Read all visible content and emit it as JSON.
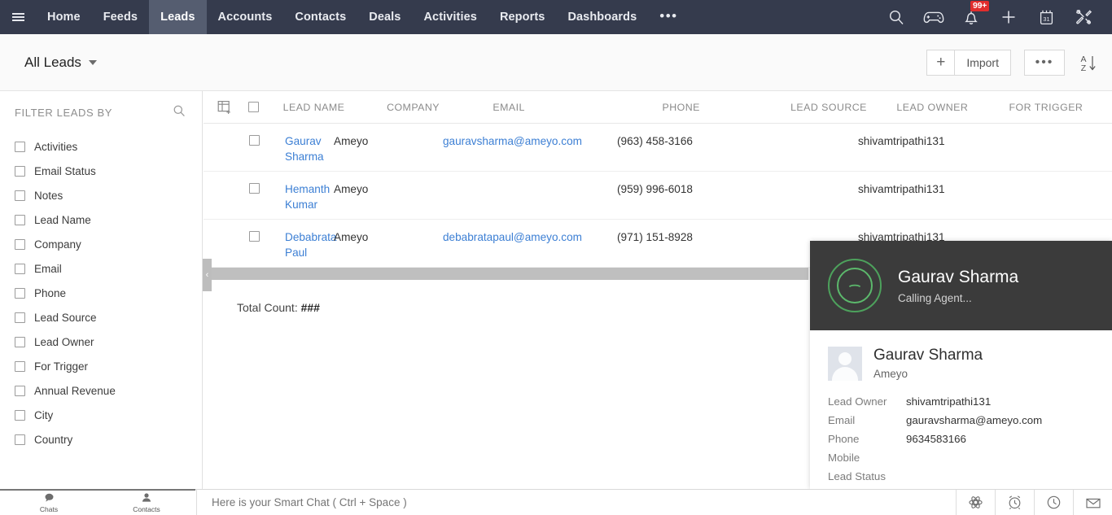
{
  "topnav": {
    "menu_icon": "hamburger-icon",
    "items": [
      {
        "label": "Home",
        "active": false
      },
      {
        "label": "Feeds",
        "active": false
      },
      {
        "label": "Leads",
        "active": true
      },
      {
        "label": "Accounts",
        "active": false
      },
      {
        "label": "Contacts",
        "active": false
      },
      {
        "label": "Deals",
        "active": false
      },
      {
        "label": "Activities",
        "active": false
      },
      {
        "label": "Reports",
        "active": false
      },
      {
        "label": "Dashboards",
        "active": false
      }
    ],
    "more_label": "•••",
    "icons": {
      "search": "search-icon",
      "gamepad": "gamepad-icon",
      "bell": "bell-icon",
      "bell_badge": "99+",
      "plus": "plus-icon",
      "calendar": "calendar-icon",
      "calendar_day": "31",
      "tools": "tools-icon"
    }
  },
  "subbar": {
    "view_name": "All Leads",
    "plus_label": "+",
    "import_label": "Import",
    "more_label": "•••",
    "sort_top": "A",
    "sort_bottom": "Z",
    "sort_arrow": "↓"
  },
  "sidebar": {
    "title": "FILTER LEADS BY",
    "search_icon": "search-icon",
    "filters": [
      {
        "label": "Activities",
        "checked": false
      },
      {
        "label": "Email Status",
        "checked": false
      },
      {
        "label": "Notes",
        "checked": false
      },
      {
        "label": "Lead Name",
        "checked": false
      },
      {
        "label": "Company",
        "checked": false
      },
      {
        "label": "Email",
        "checked": false
      },
      {
        "label": "Phone",
        "checked": false
      },
      {
        "label": "Lead Source",
        "checked": false
      },
      {
        "label": "Lead Owner",
        "checked": false
      },
      {
        "label": "For Trigger",
        "checked": false
      },
      {
        "label": "Annual Revenue",
        "checked": false
      },
      {
        "label": "City",
        "checked": false
      },
      {
        "label": "Country",
        "checked": false
      }
    ],
    "collapse_chevron": "‹"
  },
  "table": {
    "add_column_icon": "add-column-icon",
    "headers": {
      "lead_name": "LEAD NAME",
      "company": "COMPANY",
      "email": "EMAIL",
      "phone": "PHONE",
      "lead_source": "LEAD SOURCE",
      "lead_owner": "LEAD OWNER",
      "for_trigger": "FOR TRIGGER"
    },
    "rows": [
      {
        "lead_name": "Gaurav Sharma",
        "company": "Ameyo",
        "email": "gauravsharma@ameyo.com",
        "phone": "(963) 458-3166",
        "lead_source": "",
        "lead_owner": "shivamtripathi131",
        "for_trigger": ""
      },
      {
        "lead_name": "Hemanth Kumar",
        "company": "Ameyo",
        "email": "",
        "phone": "(959) 996-6018",
        "lead_source": "",
        "lead_owner": "shivamtripathi131",
        "for_trigger": ""
      },
      {
        "lead_name": "Debabrata Paul",
        "company": "Ameyo",
        "email": "debabratapaul@ameyo.com",
        "phone": "(971) 151-8928",
        "lead_source": "",
        "lead_owner": "shivamtripathi131",
        "for_trigger": ""
      }
    ],
    "total_count_label": "Total Count:",
    "total_count_value": "###"
  },
  "call_panel": {
    "caller_name": "Gaurav Sharma",
    "status": "Calling Agent...",
    "phone_icon": "phone-handset-icon",
    "lead": {
      "name": "Gaurav Sharma",
      "company": "Ameyo",
      "fields": [
        {
          "key": "Lead Owner",
          "value": "shivamtripathi131"
        },
        {
          "key": "Email",
          "value": "gauravsharma@ameyo.com"
        },
        {
          "key": "Phone",
          "value": "9634583166"
        },
        {
          "key": "Mobile",
          "value": ""
        },
        {
          "key": "Lead Status",
          "value": ""
        }
      ]
    }
  },
  "bottom_bar": {
    "tabs": [
      {
        "label": "Chats",
        "icon": "chat-bubble-icon"
      },
      {
        "label": "Contacts",
        "icon": "person-icon"
      }
    ],
    "smart_chat_placeholder": "Here is your Smart Chat ( Ctrl + Space )",
    "smart_chat_value": "",
    "icons": [
      {
        "name": "settings-gear-icon"
      },
      {
        "name": "alarm-clock-icon"
      },
      {
        "name": "clock-icon"
      },
      {
        "name": "envelope-icon"
      }
    ]
  },
  "colors": {
    "navbar": "#353b4d",
    "nav_active": "#555d70",
    "link": "#3c7fd4",
    "badge_red": "#e12d2d",
    "call_dark": "#3b3b3b",
    "ring_green": "#5cb96c"
  }
}
